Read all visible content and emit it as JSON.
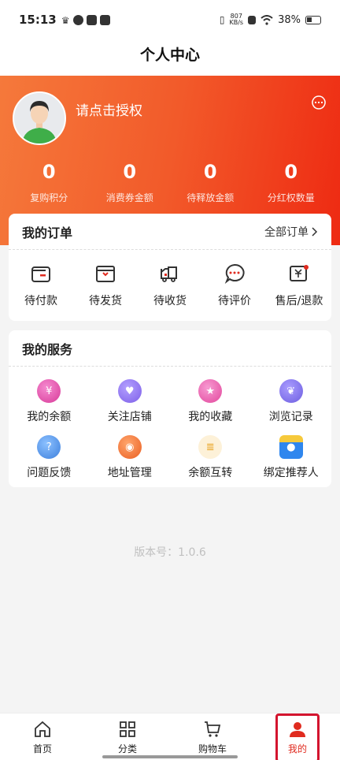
{
  "status_bar": {
    "time": "15:13",
    "net_speed_value": "807",
    "net_speed_unit": "KB/s",
    "battery": "38%"
  },
  "page_title": "个人中心",
  "profile": {
    "auth_text": "请点击授权"
  },
  "stats": [
    {
      "value": "0",
      "label": "复购积分"
    },
    {
      "value": "0",
      "label": "消费券金额"
    },
    {
      "value": "0",
      "label": "待释放金额"
    },
    {
      "value": "0",
      "label": "分红权数量"
    }
  ],
  "orders": {
    "title": "我的订单",
    "all_label": "全部订单",
    "items": [
      {
        "label": "待付款",
        "icon": "wallet-icon"
      },
      {
        "label": "待发货",
        "icon": "package-icon"
      },
      {
        "label": "待收货",
        "icon": "truck-icon"
      },
      {
        "label": "待评价",
        "icon": "comment-icon"
      },
      {
        "label": "售后/退款",
        "icon": "refund-icon"
      }
    ]
  },
  "services": {
    "title": "我的服务",
    "items": [
      {
        "label": "我的余额",
        "icon": "balance-icon",
        "color": "#e14fa8"
      },
      {
        "label": "关注店铺",
        "icon": "heart-icon",
        "color": "#8b6ef0"
      },
      {
        "label": "我的收藏",
        "icon": "star-icon",
        "color": "#ec5ba6"
      },
      {
        "label": "浏览记录",
        "icon": "footprint-icon",
        "color": "#7a6ee8"
      },
      {
        "label": "问题反馈",
        "icon": "question-icon",
        "color": "#4a90e2"
      },
      {
        "label": "地址管理",
        "icon": "location-icon",
        "color": "#f2753a"
      },
      {
        "label": "余额互转",
        "icon": "coins-icon",
        "color": "#f2b441"
      },
      {
        "label": "绑定推荐人",
        "icon": "lock-icon",
        "color": "#3a8ff0"
      }
    ]
  },
  "version_text": "版本号：1.0.6",
  "bottom_nav": [
    {
      "label": "首页",
      "icon": "home-icon"
    },
    {
      "label": "分类",
      "icon": "grid-icon"
    },
    {
      "label": "购物车",
      "icon": "cart-icon"
    },
    {
      "label": "我的",
      "icon": "user-icon"
    }
  ],
  "colors": {
    "accent": "#ee2a12",
    "header_start": "#f5793b",
    "active_nav": "#e02b1f",
    "highlight_box": "#d3142e"
  }
}
